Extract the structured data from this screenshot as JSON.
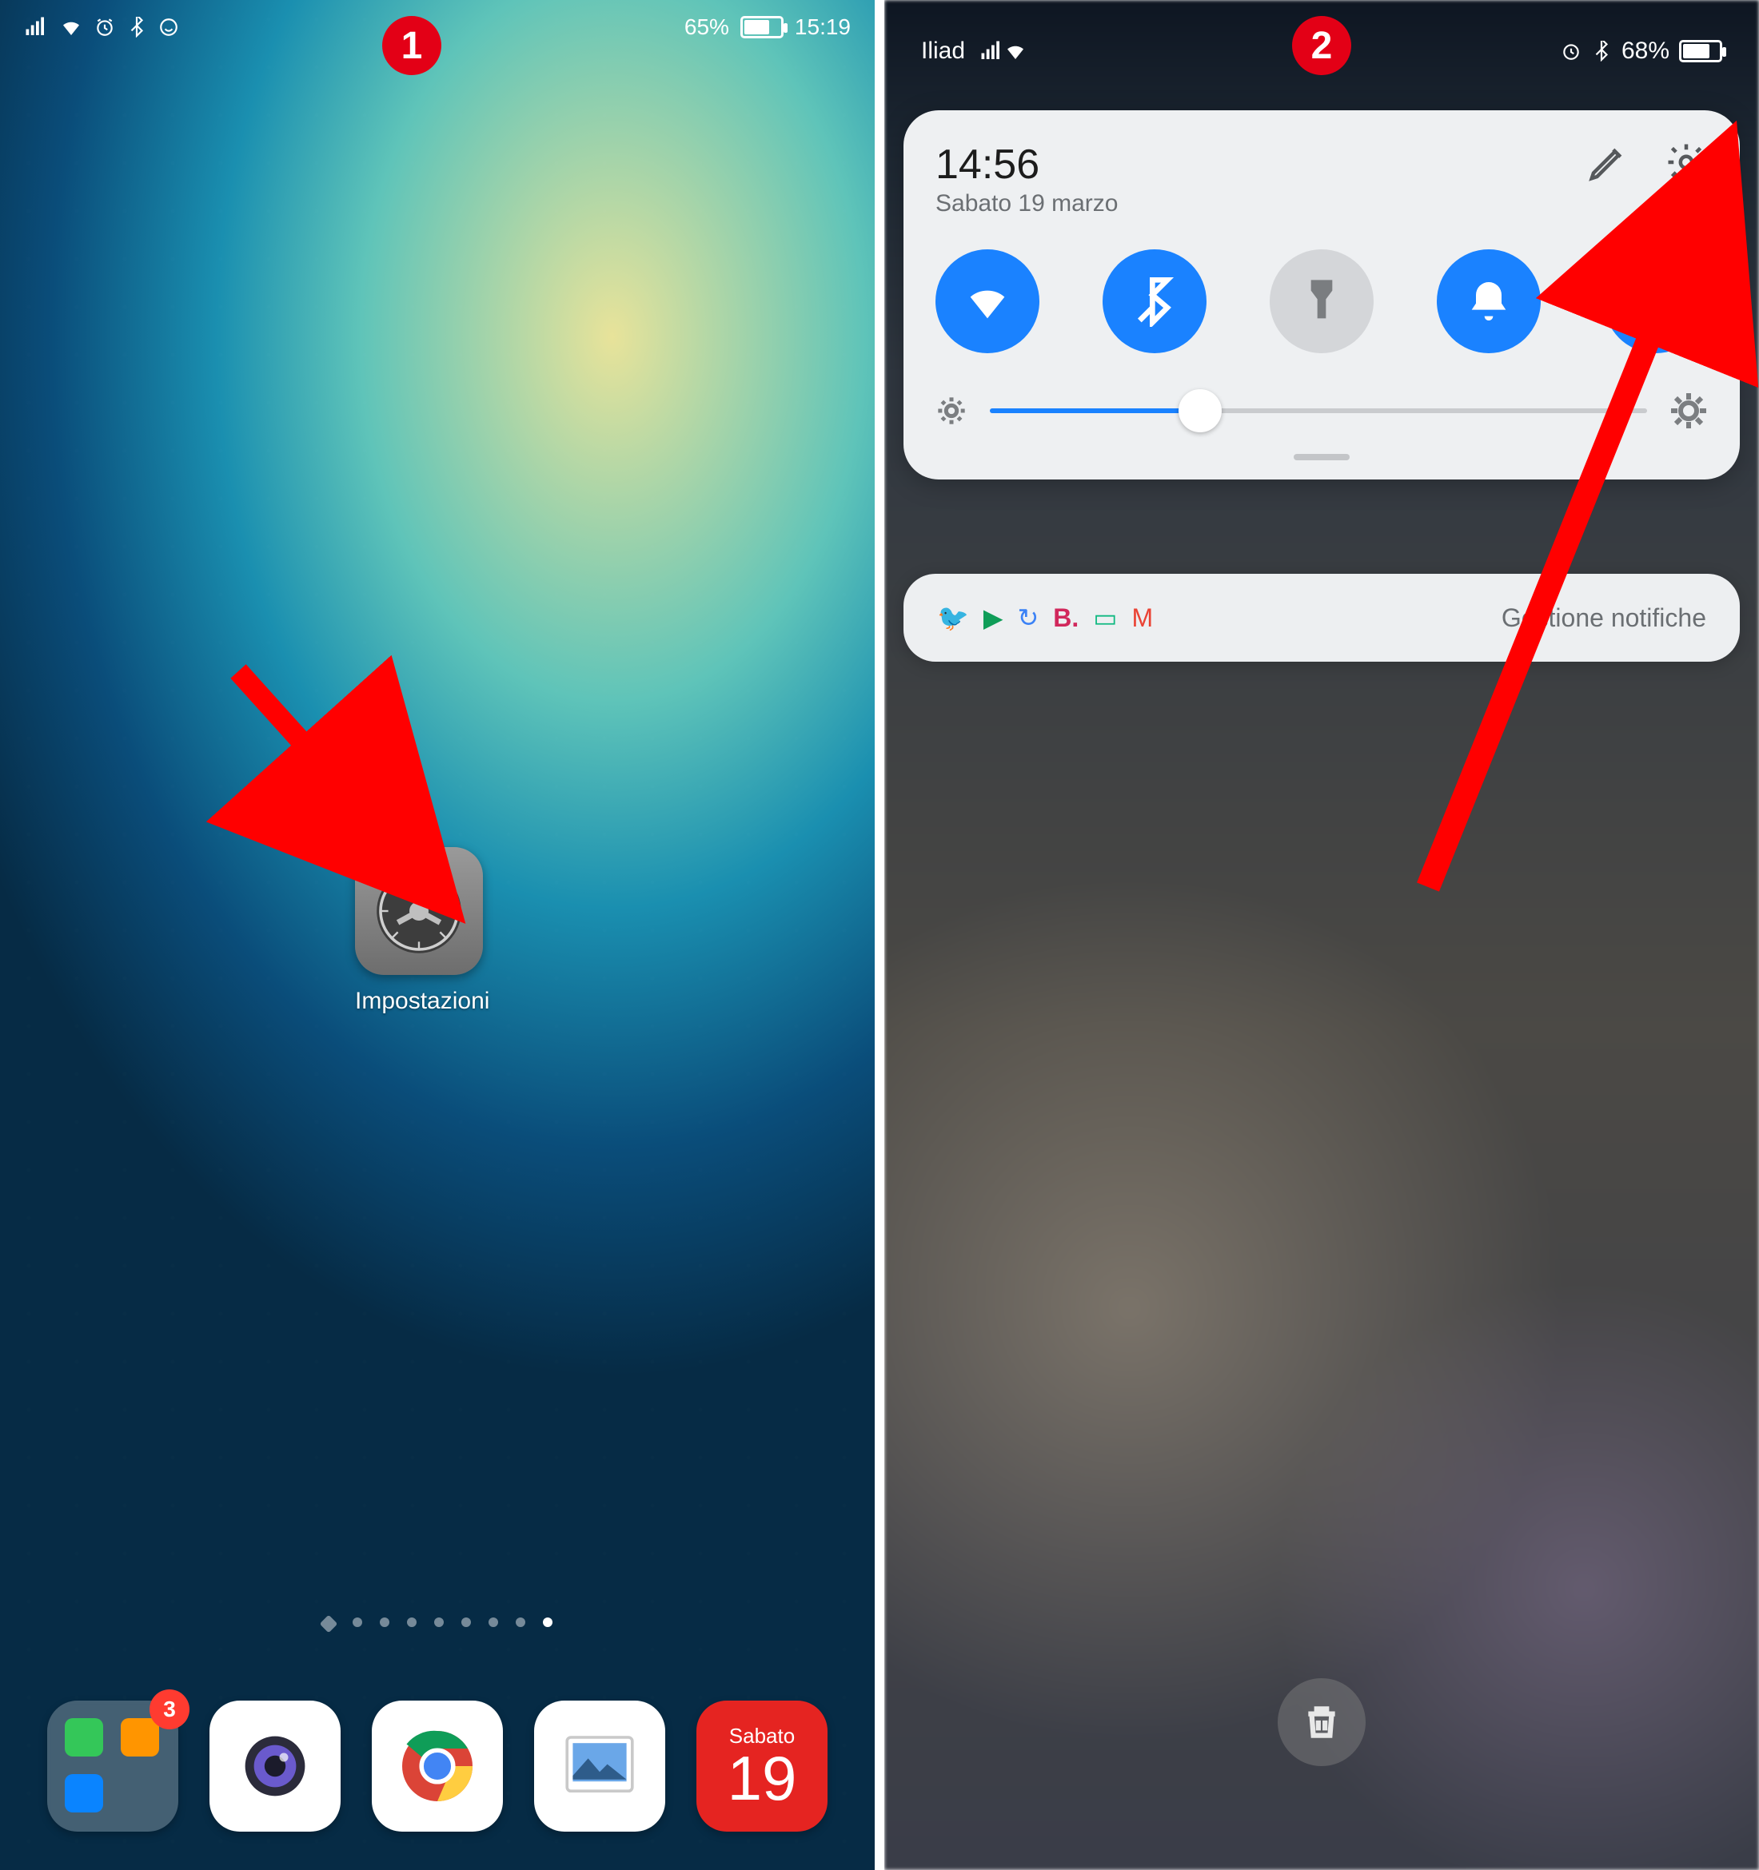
{
  "panel1": {
    "step": "1",
    "statusbar": {
      "battery_text": "65%",
      "time": "15:19"
    },
    "app": {
      "label": "Impostazioni"
    },
    "dock": {
      "folder_badge": "3",
      "calendar": {
        "day": "Sabato",
        "num": "19"
      }
    }
  },
  "panel2": {
    "step": "2",
    "statusbar": {
      "carrier": "Iliad",
      "battery_text": "68%"
    },
    "quicksettings": {
      "time": "14:56",
      "date": "Sabato 19 marzo"
    },
    "notifications": {
      "label": "Gestione notifiche"
    }
  }
}
